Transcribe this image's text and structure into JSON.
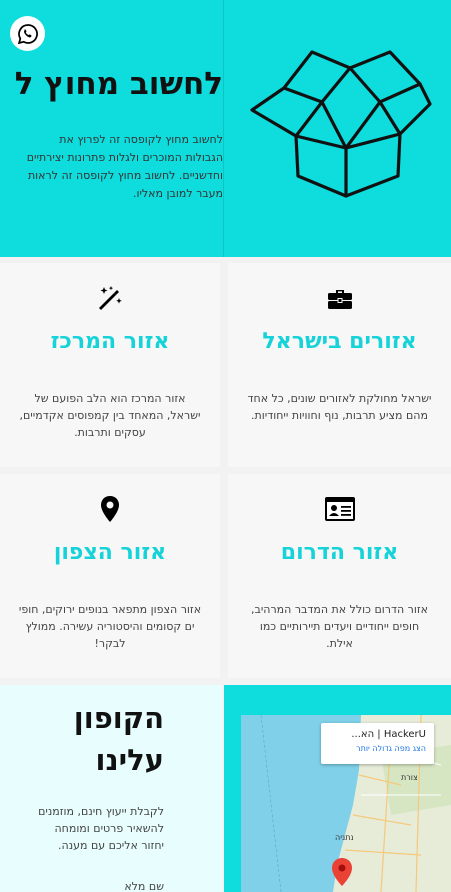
{
  "hero": {
    "title": "לחשוב מחוץ ל",
    "text": "לחשוב מחוץ לקופסה זה לפרוץ את הגבולות המוכרים ולגלות פתרונות יצירתיים וחדשניים. לחשוב מחוץ לקופסה זה לראות מעבר למובן מאליו.",
    "whatsapp_icon": "whatsapp-icon",
    "art_icon": "open-box-icon",
    "colors": {
      "turquoise": "#0fdcdc",
      "title_accent": "#15d3d8"
    }
  },
  "cards": [
    {
      "icon": "briefcase-icon",
      "title": "אזורים בישראל",
      "text": "ישראל מחולקת לאזורים שונים, כל אחד מהם מציע תרבות, נוף וחוויות ייחודיות."
    },
    {
      "icon": "magic-wand-icon",
      "title": "אזור המרכז",
      "text": "אזור המרכז הוא הלב הפועם של ישראל, המאחד בין קמפוסים אקדמיים, עסקים ותרבות."
    },
    {
      "icon": "id-card-icon",
      "title": "אזור הדרום",
      "text": "אזור הדרום כולל את המדבר המרהיב, חופים ייחודיים ויעדים תיירותיים כמו אילת."
    },
    {
      "icon": "map-pin-icon",
      "title": "אזור הצפון",
      "text": "אזור הצפון מתפאר בנופים ירוקים, חופי ים קסומים והיסטוריה עשירה. ממולץ לבקר!"
    }
  ],
  "coupon": {
    "title_line1": "הקופון",
    "title_line2": "עלינו",
    "text": "לקבלת ייעוץ חינם, מוזמנים להשאיר פרטים ומומחה יחזור אליכם עם מענה.",
    "extra": "שם מלא"
  },
  "map": {
    "place_title": "HackerU | הא...",
    "link": "הצג מפה גדולה יותר",
    "labels": [
      "צורת",
      "נתניה"
    ],
    "pin_icon": "map-marker-icon"
  }
}
